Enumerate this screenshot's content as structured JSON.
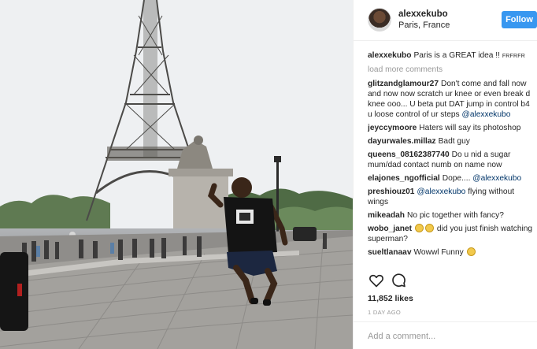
{
  "post": {
    "username": "alexxekubo",
    "location": "Paris, France",
    "follow_label": "Follow",
    "caption_user": "alexxekubo",
    "caption_text": "Paris is a GREAT idea !!",
    "caption_suffix": "FRFRFR",
    "load_more": "load more comments",
    "likes": "11,852 likes",
    "time_ago": "1 DAY AGO",
    "add_comment_placeholder": "Add a comment..."
  },
  "comments": [
    {
      "user": "glitzandglamour27",
      "text": "Don't come and fall now and now now scratch ur knee or even break d knee ooo... U beta put DAT jump in control b4 u loose control of ur steps",
      "mention": "@alexxekubo"
    },
    {
      "user": "jeyccymoore",
      "text": "Haters will say its photoshop"
    },
    {
      "user": "dayurwales.millaz",
      "text": "Badt guy"
    },
    {
      "user": "queens_08162387740",
      "text": "Do u nid a sugar mum/dad contact numb on name now"
    },
    {
      "user": "elajones_ngofficial",
      "text": "Dope....",
      "mention": "@alexxekubo"
    },
    {
      "user": "preshiouz01",
      "mention": "@alexxekubo",
      "text": "flying without wings"
    },
    {
      "user": "mikeadah",
      "text": "No pic together with fancy?"
    },
    {
      "user": "wobo_janet",
      "text": "did you just finish watching superman?"
    },
    {
      "user": "sueltlanaav",
      "text": "Wowwl Funny"
    }
  ],
  "icons": {
    "like": "heart-outline-icon",
    "comment": "speech-bubble-icon"
  },
  "colors": {
    "follow_button": "#3897f0",
    "mention_link": "#003569",
    "muted_text": "#999999",
    "divider": "#efefef"
  }
}
